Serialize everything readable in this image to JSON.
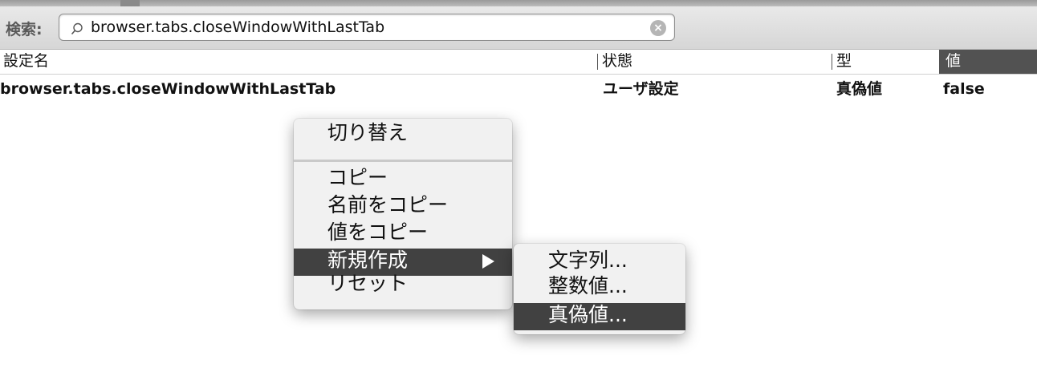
{
  "search": {
    "label": "検索:",
    "value": "browser.tabs.closeWindowWithLastTab"
  },
  "table": {
    "headers": [
      "設定名",
      "状態",
      "型",
      "値"
    ],
    "rows": [
      {
        "name": "browser.tabs.closeWindowWithLastTab",
        "status": "ユーザ設定",
        "type": "真偽値",
        "value": "false"
      }
    ]
  },
  "context_menu": {
    "toggle": "切り替え",
    "copy": "コピー",
    "copy_name": "名前をコピー",
    "copy_value": "値をコピー",
    "new": "新規作成",
    "reset": "リセット"
  },
  "submenu": {
    "string": "文字列...",
    "integer": "整数値...",
    "boolean": "真偽値..."
  }
}
